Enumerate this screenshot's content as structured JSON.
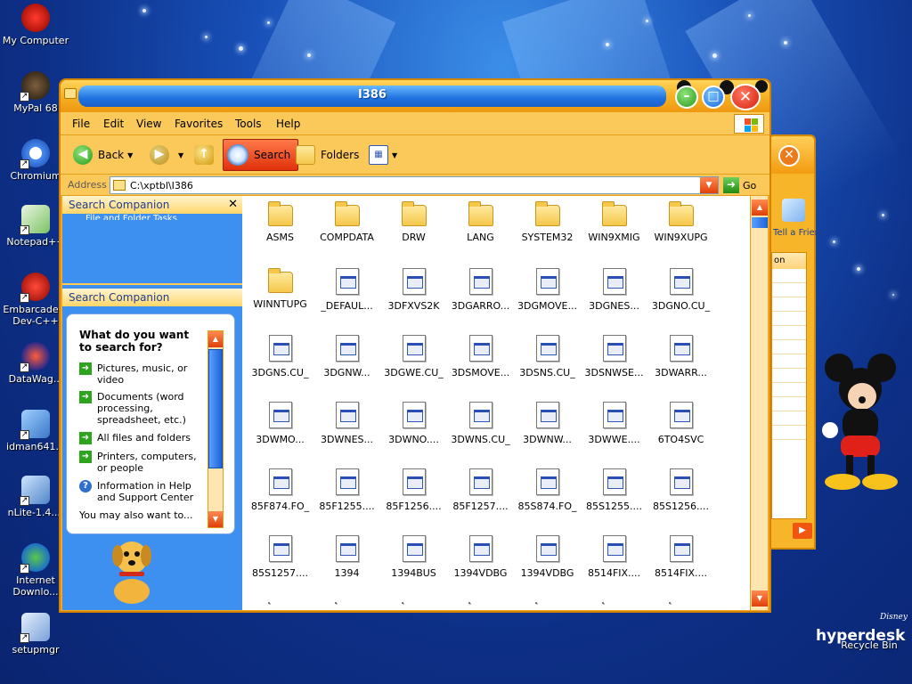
{
  "window": {
    "title": "I386"
  },
  "menu": [
    "File",
    "Edit",
    "View",
    "Favorites",
    "Tools",
    "Help"
  ],
  "toolbar": {
    "back": "Back",
    "search": "Search",
    "folders": "Folders"
  },
  "address": {
    "label": "Address",
    "value": "C:\\xptbl\\I386",
    "go": "Go"
  },
  "left_pane": {
    "header1": "Search Companion",
    "partial_text": "File and Folder Tasks",
    "header2": "Search Companion",
    "question": "What do you want to search for?",
    "options": [
      "Pictures, music, or video",
      "Documents (word processing, spreadsheet, etc.)",
      "All files and folders",
      "Printers, computers, or people",
      "Information in Help and Support Center"
    ],
    "also": "You may also want to..."
  },
  "files": [
    {
      "name": "ASMS",
      "kind": "folder"
    },
    {
      "name": "COMPDATA",
      "kind": "folder"
    },
    {
      "name": "DRW",
      "kind": "folder"
    },
    {
      "name": "LANG",
      "kind": "folder"
    },
    {
      "name": "SYSTEM32",
      "kind": "folder"
    },
    {
      "name": "WIN9XMIG",
      "kind": "folder"
    },
    {
      "name": "WIN9XUPG",
      "kind": "folder"
    },
    {
      "name": "WINNTUPG",
      "kind": "folder"
    },
    {
      "name": "_DEFAUL...",
      "kind": "doc"
    },
    {
      "name": "3DFXVS2K",
      "kind": "doc"
    },
    {
      "name": "3DGARRO...",
      "kind": "doc"
    },
    {
      "name": "3DGMOVE...",
      "kind": "doc"
    },
    {
      "name": "3DGNES...",
      "kind": "doc"
    },
    {
      "name": "3DGNO.CU_",
      "kind": "doc"
    },
    {
      "name": "3DGNS.CU_",
      "kind": "doc"
    },
    {
      "name": "3DGNW...",
      "kind": "doc"
    },
    {
      "name": "3DGWE.CU_",
      "kind": "doc"
    },
    {
      "name": "3DSMOVE...",
      "kind": "doc"
    },
    {
      "name": "3DSNS.CU_",
      "kind": "doc"
    },
    {
      "name": "3DSNWSE...",
      "kind": "doc"
    },
    {
      "name": "3DWARR...",
      "kind": "doc"
    },
    {
      "name": "3DWMO...",
      "kind": "doc"
    },
    {
      "name": "3DWNES...",
      "kind": "doc"
    },
    {
      "name": "3DWNO....",
      "kind": "doc"
    },
    {
      "name": "3DWNS.CU_",
      "kind": "doc"
    },
    {
      "name": "3DWNW...",
      "kind": "doc"
    },
    {
      "name": "3DWWE....",
      "kind": "doc"
    },
    {
      "name": "6TO4SVC",
      "kind": "doc"
    },
    {
      "name": "85F874.FO_",
      "kind": "doc"
    },
    {
      "name": "85F1255....",
      "kind": "doc"
    },
    {
      "name": "85F1256....",
      "kind": "doc"
    },
    {
      "name": "85F1257....",
      "kind": "doc"
    },
    {
      "name": "85S874.FO_",
      "kind": "doc"
    },
    {
      "name": "85S1255....",
      "kind": "doc"
    },
    {
      "name": "85S1256....",
      "kind": "doc"
    },
    {
      "name": "85S1257....",
      "kind": "doc"
    },
    {
      "name": "1394",
      "kind": "doc"
    },
    {
      "name": "1394BUS",
      "kind": "doc"
    },
    {
      "name": "1394VDBG",
      "kind": "doc"
    },
    {
      "name": "1394VDBG",
      "kind": "doc"
    },
    {
      "name": "8514FIX....",
      "kind": "doc"
    },
    {
      "name": "8514FIX....",
      "kind": "doc"
    }
  ],
  "desktop_icons": [
    "My Computer",
    "MyPal 68",
    "Chromium",
    "Notepad++",
    "Embarcadero Dev-C++",
    "DataWag...",
    "idman641...",
    "nLite-1.4....",
    "Internet Downlo...",
    "setupmgr"
  ],
  "back_window": {
    "text": "Tell a Friend",
    "header": "on"
  },
  "branding": {
    "logo": "hyperdesk",
    "sub": "Disney",
    "recycle": "Recycle Bin"
  }
}
